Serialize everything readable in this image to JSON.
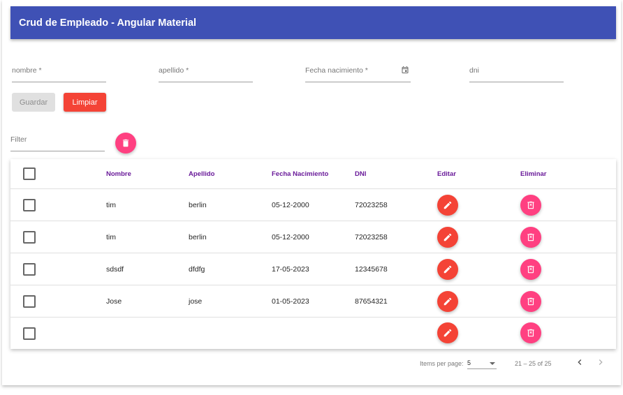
{
  "app": {
    "title": "Crud de Empleado - Angular Material"
  },
  "form": {
    "nombre_label": "nombre *",
    "apellido_label": "apellido *",
    "fecha_label": "Fecha nacimiento *",
    "dni_label": "dni",
    "save_label": "Guardar",
    "clear_label": "Limpiar"
  },
  "filter": {
    "label": "Filter",
    "delete_icon": "delete-icon"
  },
  "table": {
    "columns": {
      "nombre": "Nombre",
      "apellido": "Apellido",
      "fecha": "Fecha Nacimiento",
      "dni": "DNI",
      "editar": "Editar",
      "eliminar": "Eliminar"
    },
    "rows": [
      {
        "nombre": "tim",
        "apellido": "berlin",
        "fecha": "05-12-2000",
        "dni": "72023258"
      },
      {
        "nombre": "tim",
        "apellido": "berlin",
        "fecha": "05-12-2000",
        "dni": "72023258"
      },
      {
        "nombre": "sdsdf",
        "apellido": "dfdfg",
        "fecha": "17-05-2023",
        "dni": "12345678"
      },
      {
        "nombre": "Jose",
        "apellido": "jose",
        "fecha": "01-05-2023",
        "dni": "87654321"
      },
      {
        "nombre": "",
        "apellido": "",
        "fecha": "",
        "dni": ""
      }
    ],
    "edit_icon": "edit-icon",
    "delete_icon": "delete-icon"
  },
  "paginator": {
    "items_label": "Items per page:",
    "page_size": "5",
    "range": "21 – 25 of 25"
  },
  "colors": {
    "primary": "#3f51b5",
    "accent": "#ff4081",
    "warn": "#f44336",
    "header_text": "#6a1b9a"
  }
}
